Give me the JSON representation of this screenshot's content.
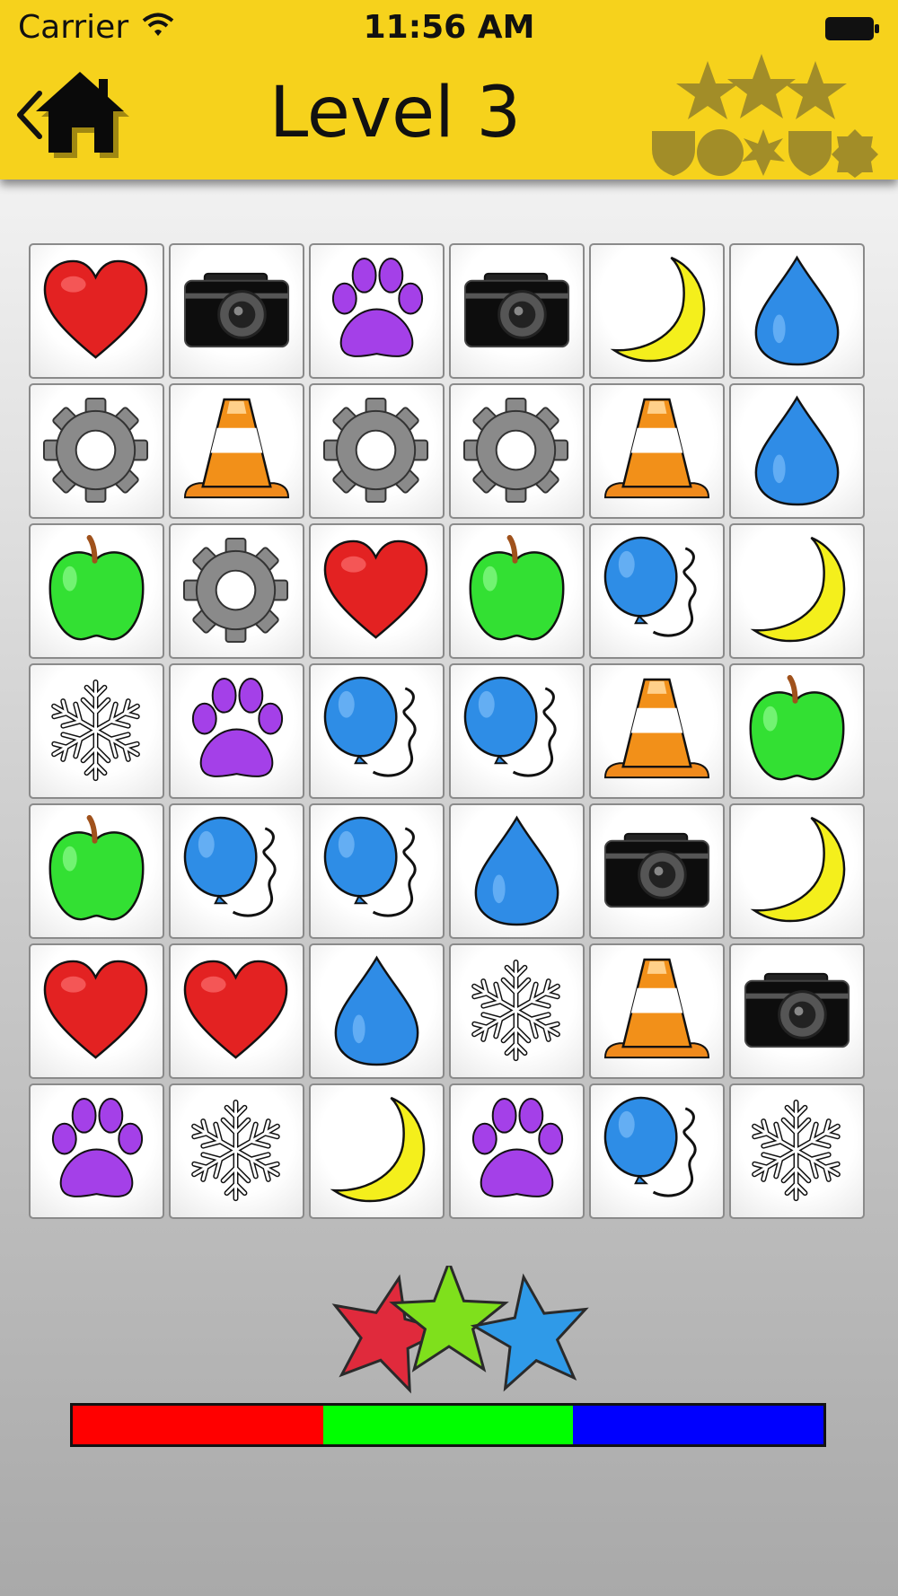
{
  "status_bar": {
    "carrier": "Carrier",
    "time": "11:56 AM",
    "wifi_icon": "wifi-icon",
    "battery_icon": "battery-icon"
  },
  "header": {
    "title": "Level 3",
    "back_icon": "home-back-icon",
    "badges_icon": "collected-shapes-icon"
  },
  "board": {
    "rows": 7,
    "cols": 6,
    "tiles": [
      [
        "heart",
        "camera",
        "paw",
        "camera",
        "moon",
        "drop"
      ],
      [
        "gear",
        "cone",
        "gear",
        "gear",
        "cone",
        "drop"
      ],
      [
        "apple",
        "gear",
        "heart",
        "apple",
        "balloon",
        "moon"
      ],
      [
        "snowflake",
        "paw",
        "balloon",
        "balloon",
        "cone",
        "apple"
      ],
      [
        "apple",
        "balloon",
        "balloon",
        "drop",
        "camera",
        "moon"
      ],
      [
        "heart",
        "heart",
        "drop",
        "snowflake",
        "cone",
        "camera"
      ],
      [
        "paw",
        "snowflake",
        "moon",
        "paw",
        "balloon",
        "snowflake"
      ]
    ]
  },
  "rating": {
    "stars": [
      {
        "name": "red-star",
        "color": "#e02a3c"
      },
      {
        "name": "green-star",
        "color": "#7fe01c"
      },
      {
        "name": "blue-star",
        "color": "#2f9ae8"
      }
    ]
  },
  "progress": {
    "segments": [
      {
        "color": "#ff0000",
        "fraction": 0.3333
      },
      {
        "color": "#00ff00",
        "fraction": 0.3334
      },
      {
        "color": "#0000ff",
        "fraction": 0.3333
      }
    ]
  },
  "colors": {
    "header": "#f6d21c",
    "badge": "#a28d28"
  }
}
